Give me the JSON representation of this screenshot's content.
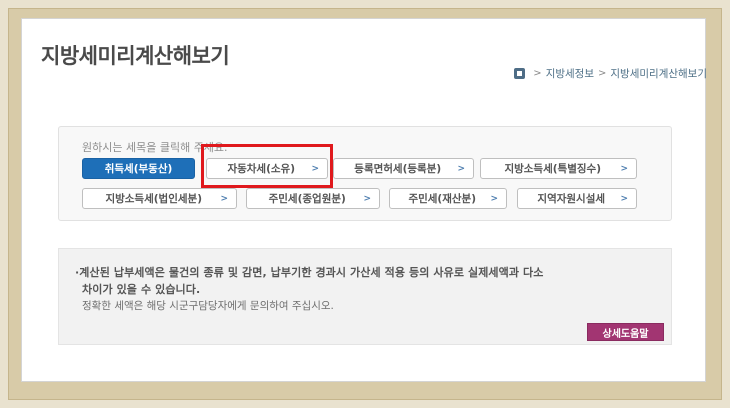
{
  "page": {
    "title": "지방세미리계산해보기"
  },
  "breadcrumb": {
    "items": [
      "지방세정보",
      "지방세미리계산해보기"
    ],
    "separator": ">"
  },
  "selector": {
    "prompt": "원하시는 세목을 클릭해 주세요.",
    "selected_index": 0,
    "highlighted_index": 1,
    "buttons": [
      {
        "label": "취득세(부동산)"
      },
      {
        "label": "자동차세(소유)"
      },
      {
        "label": "등록면허세(등록분)"
      },
      {
        "label": "지방소득세(특별징수)"
      },
      {
        "label": "지방소득세(법인세분)"
      },
      {
        "label": "주민세(종업원분)"
      },
      {
        "label": "주민세(재산분)"
      },
      {
        "label": "지역자원시설세"
      }
    ],
    "chevron": ">"
  },
  "notice": {
    "line1": "·계산된 납부세액은 물건의 종류 및 감면, 납부기한 경과시 가산세 적용 등의 사유로 실제세액과 다소",
    "line2": "차이가 있을 수 있습니다.",
    "line3": "정확한 세액은 해당 시군구담당자에게 문의하여 주십시오."
  },
  "help_button": {
    "label": "상세도움말"
  },
  "colors": {
    "active_button": "#1e6fb8",
    "highlight_border": "#e0191d",
    "help_button": "#a23572"
  }
}
